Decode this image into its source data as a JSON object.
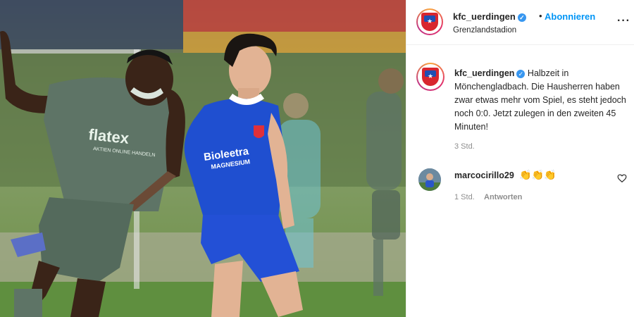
{
  "post": {
    "username": "kfc_uerdingen",
    "verified_icon": "verified-badge-icon",
    "separator": "•",
    "follow_label": "Abonnieren",
    "location": "Grenzlandstadion",
    "more_label": "···",
    "caption": "Halbzeit in Mönchengladbach. Die Hausherren haben zwar etwas mehr vom Spiel, es steht jedoch noch 0:0. Jetzt zulegen in den zweiten 45 Minuten!",
    "caption_time": "3 Std."
  },
  "comment": {
    "username": "marcocirillo29",
    "text": "👏👏👏",
    "time": "1 Std.",
    "reply_label": "Antworten"
  },
  "photo": {
    "sponsor_left": "flatex",
    "sponsor_left_sub": "AKTIEN ONLINE HANDELN",
    "sponsor_right": "Bioleetra",
    "sponsor_right_sub": "MAGNESIUM"
  },
  "colors": {
    "accent": "#0095f6",
    "text": "#262626",
    "muted": "#8e8e8e",
    "kit_blue": "#1f4fd0",
    "kit_green": "#5e7466"
  }
}
